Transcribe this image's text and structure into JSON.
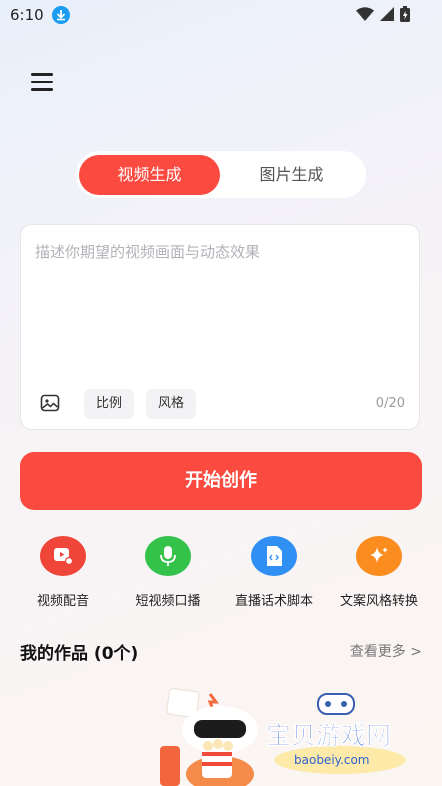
{
  "status": {
    "time": "6:10"
  },
  "tabs": {
    "video": "视频生成",
    "image": "图片生成"
  },
  "prompt": {
    "placeholder": "描述你期望的视频画面与动态效果",
    "ratio": "比例",
    "style": "风格",
    "count": "0/20"
  },
  "start_button": "开始创作",
  "tools": [
    {
      "label": "视频配音",
      "icon": "video-dubbing-icon",
      "color": "#f0463a"
    },
    {
      "label": "短视频口播",
      "icon": "microphone-icon",
      "color": "#34c24a"
    },
    {
      "label": "直播话术脚本",
      "icon": "script-file-icon",
      "color": "#2f8ff3"
    },
    {
      "label": "文案风格转换",
      "icon": "sparkle-icon",
      "color": "#fb8d1e"
    }
  ],
  "works": {
    "title": "我的作品 (0个)",
    "more": "查看更多 >"
  },
  "watermark": {
    "brand": "宝贝游戏网",
    "domain": "baobeiy.com"
  },
  "colors": {
    "accent": "#fb4a3f"
  }
}
